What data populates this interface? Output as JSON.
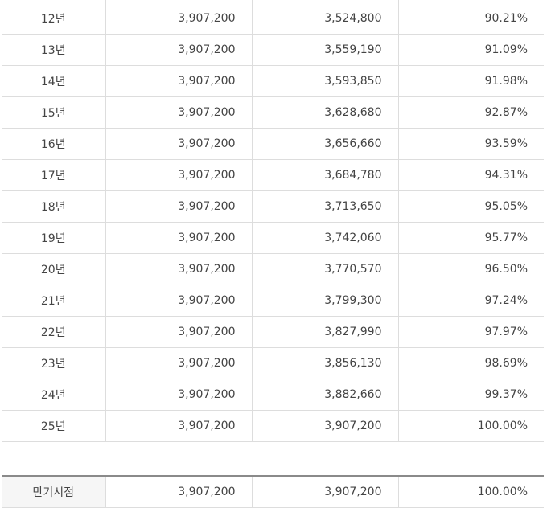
{
  "rows": [
    {
      "year": "12년",
      "amount_a": "3,907,200",
      "amount_b": "3,524,800",
      "rate": "90.21%"
    },
    {
      "year": "13년",
      "amount_a": "3,907,200",
      "amount_b": "3,559,190",
      "rate": "91.09%"
    },
    {
      "year": "14년",
      "amount_a": "3,907,200",
      "amount_b": "3,593,850",
      "rate": "91.98%"
    },
    {
      "year": "15년",
      "amount_a": "3,907,200",
      "amount_b": "3,628,680",
      "rate": "92.87%"
    },
    {
      "year": "16년",
      "amount_a": "3,907,200",
      "amount_b": "3,656,660",
      "rate": "93.59%"
    },
    {
      "year": "17년",
      "amount_a": "3,907,200",
      "amount_b": "3,684,780",
      "rate": "94.31%"
    },
    {
      "year": "18년",
      "amount_a": "3,907,200",
      "amount_b": "3,713,650",
      "rate": "95.05%"
    },
    {
      "year": "19년",
      "amount_a": "3,907,200",
      "amount_b": "3,742,060",
      "rate": "95.77%"
    },
    {
      "year": "20년",
      "amount_a": "3,907,200",
      "amount_b": "3,770,570",
      "rate": "96.50%"
    },
    {
      "year": "21년",
      "amount_a": "3,907,200",
      "amount_b": "3,799,300",
      "rate": "97.24%"
    },
    {
      "year": "22년",
      "amount_a": "3,907,200",
      "amount_b": "3,827,990",
      "rate": "97.97%"
    },
    {
      "year": "23년",
      "amount_a": "3,907,200",
      "amount_b": "3,856,130",
      "rate": "98.69%"
    },
    {
      "year": "24년",
      "amount_a": "3,907,200",
      "amount_b": "3,882,660",
      "rate": "99.37%"
    },
    {
      "year": "25년",
      "amount_a": "3,907,200",
      "amount_b": "3,907,200",
      "rate": "100.00%"
    }
  ],
  "summary": {
    "label": "만기시점",
    "amount_a": "3,907,200",
    "amount_b": "3,907,200",
    "rate": "100.00%"
  }
}
